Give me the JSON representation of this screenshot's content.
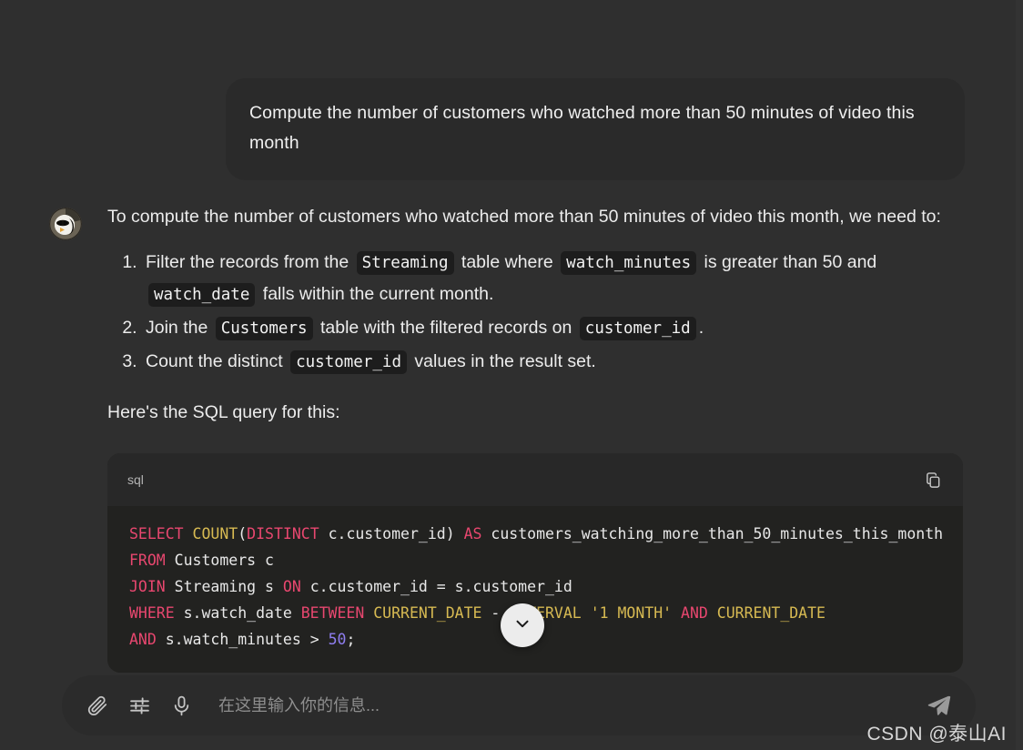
{
  "colors": {
    "background": "#2f2f2f",
    "user_bubble": "#2a2a2a",
    "code_header": "#282828",
    "code_body": "#222220",
    "composer": "#2b2b2b",
    "keyword": "#e8476f",
    "function": "#d7ba52",
    "number": "#8f7ef0"
  },
  "user_message": {
    "text": "Compute the number of customers who watched more than 50 minutes of video this month"
  },
  "assistant_message": {
    "avatar_name": "assistant-avatar",
    "intro": "To compute the number of customers who watched more than 50 minutes of video this month, we need to:",
    "steps": [
      {
        "parts": [
          {
            "type": "text",
            "value": "Filter the records from the "
          },
          {
            "type": "code",
            "value": "Streaming"
          },
          {
            "type": "text",
            "value": " table where "
          },
          {
            "type": "code",
            "value": "watch_minutes"
          },
          {
            "type": "text",
            "value": " is greater than 50 and "
          },
          {
            "type": "code",
            "value": "watch_date"
          },
          {
            "type": "text",
            "value": " falls within the current month."
          }
        ]
      },
      {
        "parts": [
          {
            "type": "text",
            "value": "Join the "
          },
          {
            "type": "code",
            "value": "Customers"
          },
          {
            "type": "text",
            "value": " table with the filtered records on "
          },
          {
            "type": "code",
            "value": "customer_id"
          },
          {
            "type": "text",
            "value": "."
          }
        ]
      },
      {
        "parts": [
          {
            "type": "text",
            "value": "Count the distinct "
          },
          {
            "type": "code",
            "value": "customer_id"
          },
          {
            "type": "text",
            "value": " values in the result set."
          }
        ]
      }
    ],
    "sql_intro": "Here's the SQL query for this:"
  },
  "code_block": {
    "language_label": "sql",
    "copy_icon": "copy-icon",
    "lines": [
      [
        {
          "t": "kw",
          "v": "SELECT"
        },
        {
          "t": "plain",
          "v": " "
        },
        {
          "t": "fn",
          "v": "COUNT"
        },
        {
          "t": "plain",
          "v": "("
        },
        {
          "t": "kw",
          "v": "DISTINCT"
        },
        {
          "t": "plain",
          "v": " c.customer_id) "
        },
        {
          "t": "kw",
          "v": "AS"
        },
        {
          "t": "plain",
          "v": " customers_watching_more_than_50_minutes_this_month"
        }
      ],
      [
        {
          "t": "kw",
          "v": "FROM"
        },
        {
          "t": "plain",
          "v": " Customers c"
        }
      ],
      [
        {
          "t": "kw",
          "v": "JOIN"
        },
        {
          "t": "plain",
          "v": " Streaming s "
        },
        {
          "t": "kw",
          "v": "ON"
        },
        {
          "t": "plain",
          "v": " c.customer_id = s.customer_id"
        }
      ],
      [
        {
          "t": "kw",
          "v": "WHERE"
        },
        {
          "t": "plain",
          "v": " s.watch_date "
        },
        {
          "t": "kw",
          "v": "BETWEEN"
        },
        {
          "t": "plain",
          "v": " "
        },
        {
          "t": "kw2",
          "v": "CURRENT_DATE"
        },
        {
          "t": "plain",
          "v": " - "
        },
        {
          "t": "kw2",
          "v": "INTERVAL"
        },
        {
          "t": "plain",
          "v": " "
        },
        {
          "t": "str",
          "v": "'1 MONTH'"
        },
        {
          "t": "plain",
          "v": " "
        },
        {
          "t": "kw",
          "v": "AND"
        },
        {
          "t": "plain",
          "v": " "
        },
        {
          "t": "kw2",
          "v": "CURRENT_DATE"
        }
      ],
      [
        {
          "t": "kw",
          "v": "AND"
        },
        {
          "t": "plain",
          "v": " s.watch_minutes > "
        },
        {
          "t": "num",
          "v": "50"
        },
        {
          "t": "plain",
          "v": ";"
        }
      ]
    ]
  },
  "scroll_button": {
    "icon": "chevron-down-icon"
  },
  "composer": {
    "attach_icon": "paperclip-icon",
    "settings_icon": "sliders-icon",
    "mic_icon": "microphone-icon",
    "input_value": "",
    "placeholder": "在这里输入你的信息...",
    "send_icon": "send-icon"
  },
  "watermark": {
    "text": "CSDN @泰山AI"
  }
}
